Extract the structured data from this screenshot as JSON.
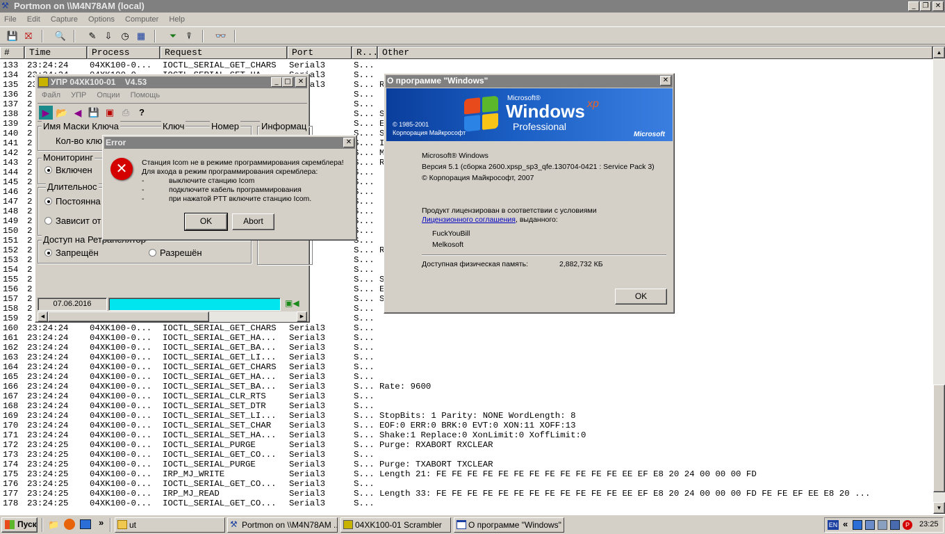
{
  "portmon": {
    "title": "Portmon on \\\\M4N78AM (local)",
    "menu": [
      "File",
      "Edit",
      "Capture",
      "Options",
      "Computer",
      "Help"
    ],
    "columns": [
      "#",
      "Time",
      "Process",
      "Request",
      "Port",
      "R...",
      "Other"
    ],
    "rows": [
      {
        "n": "133",
        "t": "23:24:24",
        "p": "04XK100-0...",
        "r": "IOCTL_SERIAL_GET_CHARS",
        "port": "Serial3",
        "res": "S...",
        "o": ""
      },
      {
        "n": "134",
        "t": "23:24:24",
        "p": "04XK100-0...",
        "r": "IOCTL_SERIAL_GET_HA...",
        "port": "Serial3",
        "res": "S...",
        "o": ""
      },
      {
        "n": "135",
        "t": "23:24:24",
        "p": "04XK100-0...",
        "r": "IOCTL_SERIAL_SET_BA...",
        "port": "Serial3",
        "res": "S...",
        "o": "R"
      },
      {
        "n": "136",
        "t": "2",
        "p": "",
        "r": "",
        "port": "al3",
        "res": "S...",
        "o": ""
      },
      {
        "n": "137",
        "t": "2",
        "p": "",
        "r": "",
        "port": "al3",
        "res": "S...",
        "o": ""
      },
      {
        "n": "138",
        "t": "2",
        "p": "",
        "r": "",
        "port": "al3",
        "res": "S...",
        "o": "S"
      },
      {
        "n": "139",
        "t": "2",
        "p": "",
        "r": "",
        "port": "al3",
        "res": "S...",
        "o": "E"
      },
      {
        "n": "140",
        "t": "2",
        "p": "",
        "r": "",
        "port": "al3",
        "res": "S...",
        "o": "S"
      },
      {
        "n": "141",
        "t": "2",
        "p": "",
        "r": "",
        "port": "al3",
        "res": "S...",
        "o": "I"
      },
      {
        "n": "142",
        "t": "2",
        "p": "",
        "r": "",
        "port": "al3",
        "res": "S...",
        "o": "M"
      },
      {
        "n": "143",
        "t": "2",
        "p": "",
        "r": "",
        "port": "al3",
        "res": "S...",
        "o": "R"
      },
      {
        "n": "144",
        "t": "2",
        "p": "",
        "r": "",
        "port": "al3",
        "res": "S...",
        "o": ""
      },
      {
        "n": "145",
        "t": "2",
        "p": "",
        "r": "",
        "port": "al3",
        "res": "S...",
        "o": ""
      },
      {
        "n": "146",
        "t": "2",
        "p": "",
        "r": "",
        "port": "al3",
        "res": "S...",
        "o": ""
      },
      {
        "n": "147",
        "t": "2",
        "p": "",
        "r": "",
        "port": "al3",
        "res": "S...",
        "o": ""
      },
      {
        "n": "148",
        "t": "2",
        "p": "",
        "r": "",
        "port": "al3",
        "res": "S...",
        "o": ""
      },
      {
        "n": "149",
        "t": "2",
        "p": "",
        "r": "",
        "port": "al3",
        "res": "S...",
        "o": ""
      },
      {
        "n": "150",
        "t": "2",
        "p": "",
        "r": "",
        "port": "al3",
        "res": "S...",
        "o": ""
      },
      {
        "n": "151",
        "t": "2",
        "p": "",
        "r": "",
        "port": "al3",
        "res": "S...",
        "o": ""
      },
      {
        "n": "152",
        "t": "2",
        "p": "",
        "r": "",
        "port": "al3",
        "res": "S...",
        "o": "R"
      },
      {
        "n": "153",
        "t": "2",
        "p": "",
        "r": "",
        "port": "al3",
        "res": "S...",
        "o": ""
      },
      {
        "n": "154",
        "t": "2",
        "p": "",
        "r": "",
        "port": "al3",
        "res": "S...",
        "o": ""
      },
      {
        "n": "155",
        "t": "2",
        "p": "",
        "r": "",
        "port": "al3",
        "res": "S...",
        "o": "S"
      },
      {
        "n": "156",
        "t": "2",
        "p": "",
        "r": "",
        "port": "al3",
        "res": "S...",
        "o": "E"
      },
      {
        "n": "157",
        "t": "2",
        "p": "",
        "r": "",
        "port": "al3",
        "res": "S...",
        "o": "S"
      },
      {
        "n": "158",
        "t": "2",
        "p": "",
        "r": "",
        "port": "al3",
        "res": "S...",
        "o": ""
      },
      {
        "n": "159",
        "t": "2",
        "p": "",
        "r": "",
        "port": "al3",
        "res": "S...",
        "o": ""
      },
      {
        "n": "160",
        "t": "23:24:24",
        "p": "04XK100-0...",
        "r": "IOCTL_SERIAL_GET_CHARS",
        "port": "Serial3",
        "res": "S...",
        "o": ""
      },
      {
        "n": "161",
        "t": "23:24:24",
        "p": "04XK100-0...",
        "r": "IOCTL_SERIAL_GET_HA...",
        "port": "Serial3",
        "res": "S...",
        "o": ""
      },
      {
        "n": "162",
        "t": "23:24:24",
        "p": "04XK100-0...",
        "r": "IOCTL_SERIAL_GET_BA...",
        "port": "Serial3",
        "res": "S...",
        "o": ""
      },
      {
        "n": "163",
        "t": "23:24:24",
        "p": "04XK100-0...",
        "r": "IOCTL_SERIAL_GET_LI...",
        "port": "Serial3",
        "res": "S...",
        "o": ""
      },
      {
        "n": "164",
        "t": "23:24:24",
        "p": "04XK100-0...",
        "r": "IOCTL_SERIAL_GET_CHARS",
        "port": "Serial3",
        "res": "S...",
        "o": ""
      },
      {
        "n": "165",
        "t": "23:24:24",
        "p": "04XK100-0...",
        "r": "IOCTL_SERIAL_GET_HA...",
        "port": "Serial3",
        "res": "S...",
        "o": ""
      },
      {
        "n": "166",
        "t": "23:24:24",
        "p": "04XK100-0...",
        "r": "IOCTL_SERIAL_SET_BA...",
        "port": "Serial3",
        "res": "S...",
        "o": "Rate: 9600"
      },
      {
        "n": "167",
        "t": "23:24:24",
        "p": "04XK100-0...",
        "r": "IOCTL_SERIAL_CLR_RTS",
        "port": "Serial3",
        "res": "S...",
        "o": ""
      },
      {
        "n": "168",
        "t": "23:24:24",
        "p": "04XK100-0...",
        "r": "IOCTL_SERIAL_SET_DTR",
        "port": "Serial3",
        "res": "S...",
        "o": ""
      },
      {
        "n": "169",
        "t": "23:24:24",
        "p": "04XK100-0...",
        "r": "IOCTL_SERIAL_SET_LI...",
        "port": "Serial3",
        "res": "S...",
        "o": "StopBits: 1 Parity: NONE WordLength: 8"
      },
      {
        "n": "170",
        "t": "23:24:24",
        "p": "04XK100-0...",
        "r": "IOCTL_SERIAL_SET_CHAR",
        "port": "Serial3",
        "res": "S...",
        "o": "EOF:0 ERR:0 BRK:0 EVT:0 XON:11 XOFF:13"
      },
      {
        "n": "171",
        "t": "23:24:24",
        "p": "04XK100-0...",
        "r": "IOCTL_SERIAL_SET_HA...",
        "port": "Serial3",
        "res": "S...",
        "o": "Shake:1 Replace:0 XonLimit:0 XoffLimit:0"
      },
      {
        "n": "172",
        "t": "23:24:25",
        "p": "04XK100-0...",
        "r": "IOCTL_SERIAL_PURGE",
        "port": "Serial3",
        "res": "S...",
        "o": "Purge: RXABORT RXCLEAR"
      },
      {
        "n": "173",
        "t": "23:24:25",
        "p": "04XK100-0...",
        "r": "IOCTL_SERIAL_GET_CO...",
        "port": "Serial3",
        "res": "S...",
        "o": ""
      },
      {
        "n": "174",
        "t": "23:24:25",
        "p": "04XK100-0...",
        "r": "IOCTL_SERIAL_PURGE",
        "port": "Serial3",
        "res": "S...",
        "o": "Purge: TXABORT TXCLEAR"
      },
      {
        "n": "175",
        "t": "23:24:25",
        "p": "04XK100-0...",
        "r": "IRP_MJ_WRITE",
        "port": "Serial3",
        "res": "S...",
        "o": "Length 21: FE FE FE FE FE FE FE FE FE FE FE FE EE EF E8 20 24 00 00 00 FD"
      },
      {
        "n": "176",
        "t": "23:24:25",
        "p": "04XK100-0...",
        "r": "IOCTL_SERIAL_GET_CO...",
        "port": "Serial3",
        "res": "S...",
        "o": ""
      },
      {
        "n": "177",
        "t": "23:24:25",
        "p": "04XK100-0...",
        "r": "IRP_MJ_READ",
        "port": "Serial3",
        "res": "S...",
        "o": "Length 33: FE FE FE FE FE FE FE FE FE FE FE FE EE EF E8 20 24 00 00 00 FD FE FE EF EE E8 20 ..."
      },
      {
        "n": "178",
        "t": "23:24:25",
        "p": "04XK100-0...",
        "r": "IOCTL_SERIAL_GET_CO...",
        "port": "Serial3",
        "res": "S...",
        "o": ""
      }
    ]
  },
  "upr": {
    "title": "УПР 04ХК100-01    V4.53",
    "menu": [
      "Файл",
      "УПР",
      "Опции",
      "Помощь"
    ],
    "col1": "Имя Маски Ключа",
    "col2": "Ключ",
    "col3": "Номер",
    "col4": "Информац",
    "count_label": "Кол-во клю",
    "monitoring": "Мониторинг",
    "enabled": "Включен",
    "duration": "Длительнос",
    "constant": "Постоянна",
    "depends": "Зависит от",
    "access": "Доступ на Ретранслятор",
    "denied": "Запрещён",
    "allowed": "Разрешён",
    "date": "07.06.2016"
  },
  "error_dialog": {
    "title": "Error",
    "line1": "Станция Icom не в режиме программирования скремблера!",
    "line2": "Для входа в режим программирования скремблера:",
    "items": [
      {
        "dash": "-",
        "text": "выключите станцию Icom"
      },
      {
        "dash": "-",
        "text": "подключите кабель программирования"
      },
      {
        "dash": "-",
        "text": "при нажатой PTT включите станцию Icom."
      }
    ],
    "ok": "OK",
    "abort": "Abort"
  },
  "about": {
    "title": "О программе \"Windows\"",
    "banner_ms": "Microsoft®",
    "banner_windows": "Windows",
    "banner_xp": "xp",
    "banner_professional": "Professional",
    "banner_copy1": "© 1985-2001",
    "banner_copy2": "Корпорация Майкрософт",
    "banner_microsoft": "Microsoft",
    "line1": "Microsoft® Windows",
    "line2": "Версия 5.1 (сборка 2600.xpsp_sp3_qfe.130704-0421 : Service Pack 3)",
    "line3": "© Корпорация Майкрософт, 2007",
    "lic1": "Продукт лицензирован в соответствии с условиями",
    "lic_link": "Лицензионного соглашения",
    "lic2": ", выданного:",
    "user1": "FuckYouBill",
    "user2": "Melkosoft",
    "mem_label": "Доступная физическая память:",
    "mem_value": "2,882,732 КБ",
    "ok": "OK"
  },
  "taskbar": {
    "start": "Пуск",
    "buttons": [
      "ut",
      "Portmon on \\\\M4N78AM ...",
      "04XK100-01 Scrambler",
      "О программе \"Windows\""
    ],
    "lang": "EN",
    "chevron": "«",
    "time": "23:25",
    "quick_chevron": "»"
  }
}
